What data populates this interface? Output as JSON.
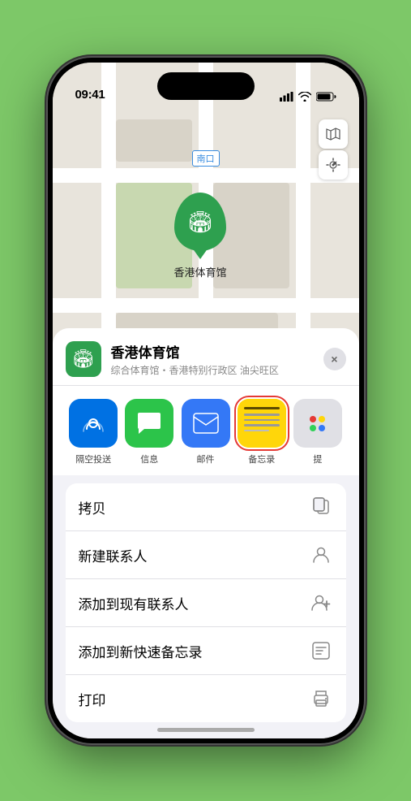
{
  "status_bar": {
    "time": "09:41",
    "location_icon": "▶"
  },
  "map": {
    "label_nankou": "南口"
  },
  "venue": {
    "name": "香港体育馆",
    "description": "综合体育馆・香港特别行政区 油尖旺区",
    "pin_emoji": "🏟"
  },
  "share_apps": [
    {
      "id": "airdrop",
      "label": "隔空投送",
      "emoji": "📶",
      "color_class": "airdrop"
    },
    {
      "id": "messages",
      "label": "信息",
      "emoji": "💬",
      "color_class": "messages"
    },
    {
      "id": "mail",
      "label": "邮件",
      "emoji": "✉️",
      "color_class": "mail"
    },
    {
      "id": "notes",
      "label": "备忘录",
      "color_class": "notes"
    },
    {
      "id": "more",
      "label": "提",
      "color_class": "more"
    }
  ],
  "actions": [
    {
      "id": "copy",
      "label": "拷贝",
      "icon": "copy"
    },
    {
      "id": "new-contact",
      "label": "新建联系人",
      "icon": "person"
    },
    {
      "id": "add-to-contact",
      "label": "添加到现有联系人",
      "icon": "person-add"
    },
    {
      "id": "add-to-notes",
      "label": "添加到新快速备忘录",
      "icon": "notes-quick"
    },
    {
      "id": "print",
      "label": "打印",
      "icon": "printer"
    }
  ],
  "close_btn_label": "×"
}
